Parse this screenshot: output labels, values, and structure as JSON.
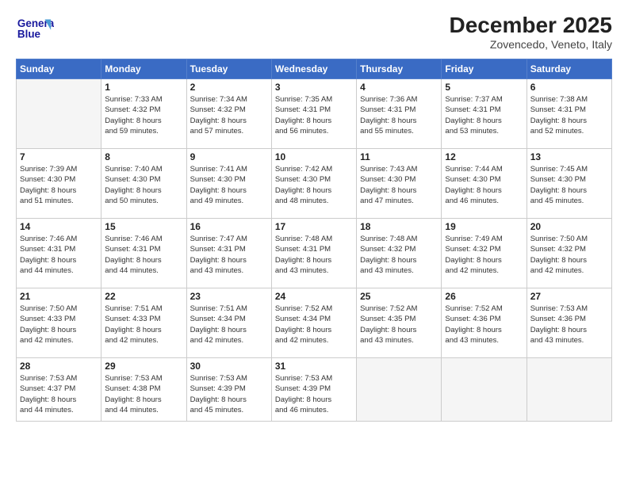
{
  "header": {
    "logo_general": "General",
    "logo_blue": "Blue",
    "month_title": "December 2025",
    "location": "Zovencedo, Veneto, Italy"
  },
  "days_of_week": [
    "Sunday",
    "Monday",
    "Tuesday",
    "Wednesday",
    "Thursday",
    "Friday",
    "Saturday"
  ],
  "weeks": [
    [
      {
        "day": "",
        "info": ""
      },
      {
        "day": "1",
        "info": "Sunrise: 7:33 AM\nSunset: 4:32 PM\nDaylight: 8 hours\nand 59 minutes."
      },
      {
        "day": "2",
        "info": "Sunrise: 7:34 AM\nSunset: 4:32 PM\nDaylight: 8 hours\nand 57 minutes."
      },
      {
        "day": "3",
        "info": "Sunrise: 7:35 AM\nSunset: 4:31 PM\nDaylight: 8 hours\nand 56 minutes."
      },
      {
        "day": "4",
        "info": "Sunrise: 7:36 AM\nSunset: 4:31 PM\nDaylight: 8 hours\nand 55 minutes."
      },
      {
        "day": "5",
        "info": "Sunrise: 7:37 AM\nSunset: 4:31 PM\nDaylight: 8 hours\nand 53 minutes."
      },
      {
        "day": "6",
        "info": "Sunrise: 7:38 AM\nSunset: 4:31 PM\nDaylight: 8 hours\nand 52 minutes."
      }
    ],
    [
      {
        "day": "7",
        "info": "Sunrise: 7:39 AM\nSunset: 4:30 PM\nDaylight: 8 hours\nand 51 minutes."
      },
      {
        "day": "8",
        "info": "Sunrise: 7:40 AM\nSunset: 4:30 PM\nDaylight: 8 hours\nand 50 minutes."
      },
      {
        "day": "9",
        "info": "Sunrise: 7:41 AM\nSunset: 4:30 PM\nDaylight: 8 hours\nand 49 minutes."
      },
      {
        "day": "10",
        "info": "Sunrise: 7:42 AM\nSunset: 4:30 PM\nDaylight: 8 hours\nand 48 minutes."
      },
      {
        "day": "11",
        "info": "Sunrise: 7:43 AM\nSunset: 4:30 PM\nDaylight: 8 hours\nand 47 minutes."
      },
      {
        "day": "12",
        "info": "Sunrise: 7:44 AM\nSunset: 4:30 PM\nDaylight: 8 hours\nand 46 minutes."
      },
      {
        "day": "13",
        "info": "Sunrise: 7:45 AM\nSunset: 4:30 PM\nDaylight: 8 hours\nand 45 minutes."
      }
    ],
    [
      {
        "day": "14",
        "info": "Sunrise: 7:46 AM\nSunset: 4:31 PM\nDaylight: 8 hours\nand 44 minutes."
      },
      {
        "day": "15",
        "info": "Sunrise: 7:46 AM\nSunset: 4:31 PM\nDaylight: 8 hours\nand 44 minutes."
      },
      {
        "day": "16",
        "info": "Sunrise: 7:47 AM\nSunset: 4:31 PM\nDaylight: 8 hours\nand 43 minutes."
      },
      {
        "day": "17",
        "info": "Sunrise: 7:48 AM\nSunset: 4:31 PM\nDaylight: 8 hours\nand 43 minutes."
      },
      {
        "day": "18",
        "info": "Sunrise: 7:48 AM\nSunset: 4:32 PM\nDaylight: 8 hours\nand 43 minutes."
      },
      {
        "day": "19",
        "info": "Sunrise: 7:49 AM\nSunset: 4:32 PM\nDaylight: 8 hours\nand 42 minutes."
      },
      {
        "day": "20",
        "info": "Sunrise: 7:50 AM\nSunset: 4:32 PM\nDaylight: 8 hours\nand 42 minutes."
      }
    ],
    [
      {
        "day": "21",
        "info": "Sunrise: 7:50 AM\nSunset: 4:33 PM\nDaylight: 8 hours\nand 42 minutes."
      },
      {
        "day": "22",
        "info": "Sunrise: 7:51 AM\nSunset: 4:33 PM\nDaylight: 8 hours\nand 42 minutes."
      },
      {
        "day": "23",
        "info": "Sunrise: 7:51 AM\nSunset: 4:34 PM\nDaylight: 8 hours\nand 42 minutes."
      },
      {
        "day": "24",
        "info": "Sunrise: 7:52 AM\nSunset: 4:34 PM\nDaylight: 8 hours\nand 42 minutes."
      },
      {
        "day": "25",
        "info": "Sunrise: 7:52 AM\nSunset: 4:35 PM\nDaylight: 8 hours\nand 43 minutes."
      },
      {
        "day": "26",
        "info": "Sunrise: 7:52 AM\nSunset: 4:36 PM\nDaylight: 8 hours\nand 43 minutes."
      },
      {
        "day": "27",
        "info": "Sunrise: 7:53 AM\nSunset: 4:36 PM\nDaylight: 8 hours\nand 43 minutes."
      }
    ],
    [
      {
        "day": "28",
        "info": "Sunrise: 7:53 AM\nSunset: 4:37 PM\nDaylight: 8 hours\nand 44 minutes."
      },
      {
        "day": "29",
        "info": "Sunrise: 7:53 AM\nSunset: 4:38 PM\nDaylight: 8 hours\nand 44 minutes."
      },
      {
        "day": "30",
        "info": "Sunrise: 7:53 AM\nSunset: 4:39 PM\nDaylight: 8 hours\nand 45 minutes."
      },
      {
        "day": "31",
        "info": "Sunrise: 7:53 AM\nSunset: 4:39 PM\nDaylight: 8 hours\nand 46 minutes."
      },
      {
        "day": "",
        "info": ""
      },
      {
        "day": "",
        "info": ""
      },
      {
        "day": "",
        "info": ""
      }
    ]
  ]
}
